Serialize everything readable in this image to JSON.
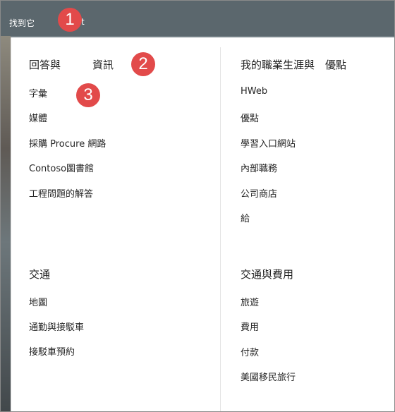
{
  "topbar": {
    "title": "找到它",
    "title_suffix": "t"
  },
  "callouts": [
    "1",
    "2",
    "3"
  ],
  "sections": {
    "answers": {
      "heading": "回答與　　　資訊",
      "links": [
        "字彙",
        "媒體",
        "採購 Procure 網路",
        "Contoso圖書館",
        "工程問題的解答"
      ]
    },
    "career": {
      "heading": "我的職業生涯與　優點",
      "links": [
        "HWeb",
        "優點",
        "學習入口網站",
        "內部職務",
        "公司商店",
        "給"
      ]
    },
    "transport": {
      "heading": "交通",
      "links": [
        "地圖",
        "通勤與接駁車",
        "接駁車預約"
      ]
    },
    "travel": {
      "heading": "交通與費用",
      "links": [
        "旅遊",
        "費用",
        "付款",
        "美國移民旅行"
      ]
    }
  }
}
